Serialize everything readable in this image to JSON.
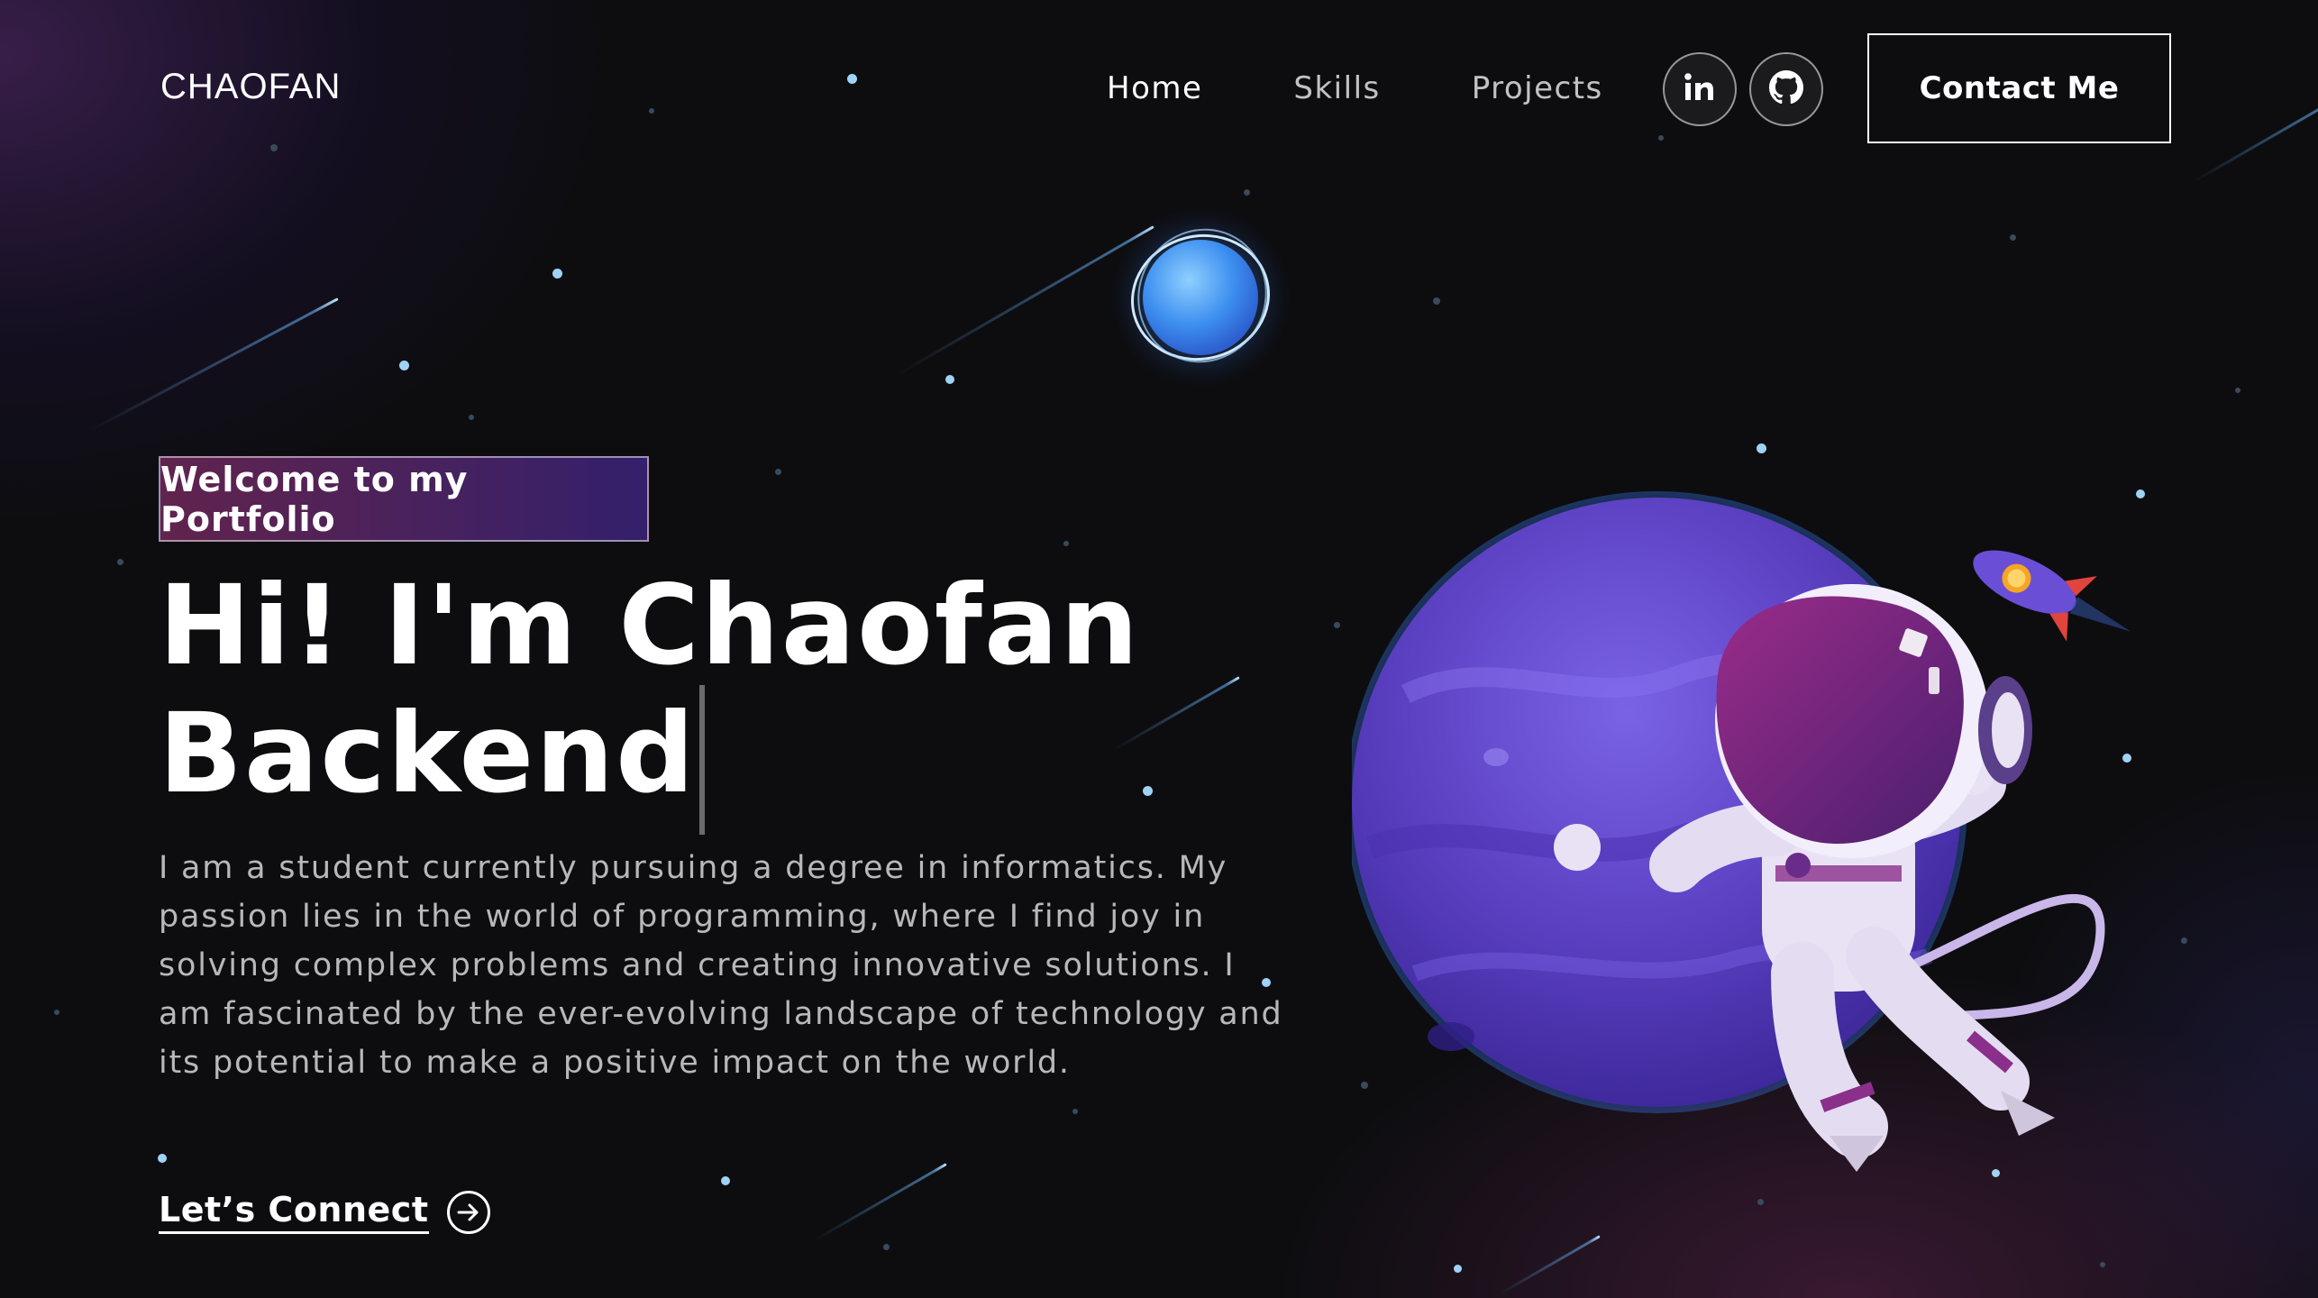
{
  "nav": {
    "logo": "CHAOFAN",
    "links": [
      {
        "label": "Home",
        "active": true
      },
      {
        "label": "Skills",
        "active": false
      },
      {
        "label": "Projects",
        "active": false
      }
    ],
    "social": [
      {
        "icon": "linkedin-icon"
      },
      {
        "icon": "github-icon"
      }
    ],
    "contact_label": "Contact Me"
  },
  "hero": {
    "tagline": "Welcome to my Portfolio",
    "headline_line1": "Hi! I'm Chaofan",
    "headline_line2": "Backend",
    "bio": "I am a student currently pursuing a degree in informatics. My passion lies in the world of programming, where I find joy in solving complex problems and creating innovative solutions. I am fascinated by the ever-evolving landscape of technology and its potential to make a positive impact on the world.",
    "cta_label": "Let’s Connect",
    "cta_icon": "arrow-right-circle-icon"
  },
  "colors": {
    "background": "#0d0d10",
    "accent_pink": "#aa367c",
    "accent_purple": "#4a2fbd",
    "planet": "#5a3fc0",
    "star": "#9fd3f5"
  }
}
